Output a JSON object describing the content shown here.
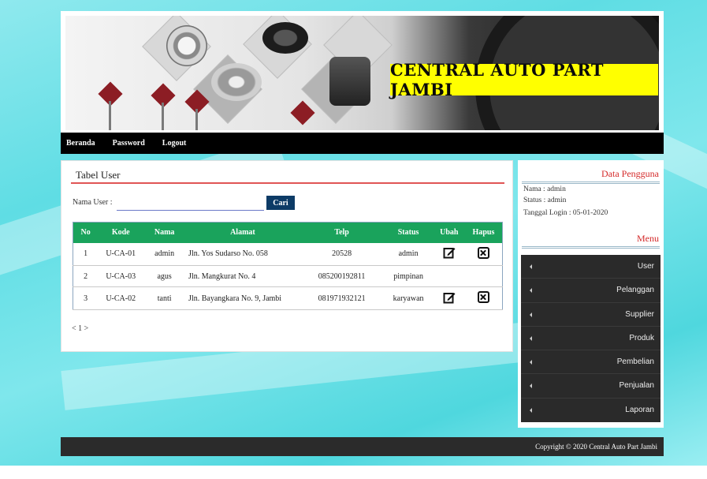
{
  "banner": {
    "title": "CENTRAL AUTO PART JAMBI"
  },
  "nav": {
    "items": [
      "Beranda",
      "Password",
      "Logout"
    ]
  },
  "content": {
    "heading": "Tabel User",
    "search_label": "Nama User :",
    "search_value": "",
    "search_button": "Cari",
    "columns": [
      "No",
      "Kode",
      "Nama",
      "Alamat",
      "Telp",
      "Status",
      "Ubah",
      "Hapus"
    ],
    "rows": [
      {
        "no": "1",
        "kode": "U-CA-01",
        "nama": "admin",
        "alamat": "Jln. Yos Sudarso No. 058",
        "telp": "20528",
        "status": "admin",
        "edit": true,
        "delete": true
      },
      {
        "no": "2",
        "kode": "U-CA-03",
        "nama": "agus",
        "alamat": "Jln. Mangkurat No. 4",
        "telp": "085200192811",
        "status": "pimpinan",
        "edit": false,
        "delete": false
      },
      {
        "no": "3",
        "kode": "U-CA-02",
        "nama": "tanti",
        "alamat": "Jln. Bayangkara No. 9, Jambi",
        "telp": "081971932121",
        "status": "karyawan",
        "edit": true,
        "delete": true
      }
    ],
    "pager": "< 1 >"
  },
  "sidebar": {
    "user_title": "Data Pengguna",
    "nama": "Nama : admin",
    "status": "Status : admin",
    "login": "Tanggal Login : 05-01-2020",
    "menu_title": "Menu",
    "menu": [
      "User",
      "Pelanggan",
      "Supplier",
      "Produk",
      "Pembelian",
      "Penjualan",
      "Laporan"
    ]
  },
  "footer": {
    "text": "Copyright © 2020 Central Auto Part Jambi"
  },
  "colors": {
    "table_header": "#1aa35c",
    "search_button": "#0d3b66",
    "accent_red": "#d42a2a",
    "banner_title_bg": "#ffff00"
  }
}
